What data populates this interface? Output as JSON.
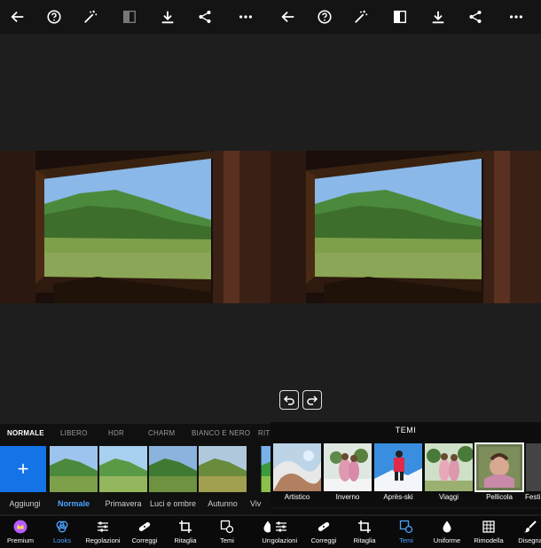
{
  "left": {
    "categories": [
      "NORMALE",
      "LIBERO",
      "HDR",
      "CHARM",
      "BIANCO E NERO",
      "RITI"
    ],
    "active_category": "NORMALE",
    "add_symbol": "+",
    "looks": [
      "Aggiungi",
      "Normale",
      "Primavera",
      "Luci e ombre",
      "Autunno",
      "Viv"
    ],
    "active_look": "Normale",
    "nav": [
      "Premium",
      "Looks",
      "Regolazioni",
      "Correggi",
      "Ritaglia",
      "Temi",
      "Unif"
    ],
    "active_nav": "Looks"
  },
  "right": {
    "header": "TEMI",
    "themes": [
      "Artistico",
      "Inverno",
      "Après-ski",
      "Viaggi",
      "Pellicola",
      "Festi"
    ],
    "selected_theme": "Pellicola",
    "nav": [
      "orgolazioni",
      "Correggi",
      "Ritaglia",
      "Temi",
      "Uniforme",
      "Rimodella",
      "Disegna"
    ],
    "active_nav": "Temi"
  },
  "colors": {
    "accent": "#1473e6",
    "active_text": "#4aa3ff",
    "panel_bg": "#1e1e1e",
    "bar_bg": "#101010"
  },
  "icons": {
    "topbar": [
      "back-arrow-icon",
      "help-icon",
      "magic-wand-icon",
      "compare-icon",
      "download-icon",
      "share-icon",
      "more-icon"
    ],
    "undo": [
      "undo-icon",
      "redo-icon"
    ]
  }
}
